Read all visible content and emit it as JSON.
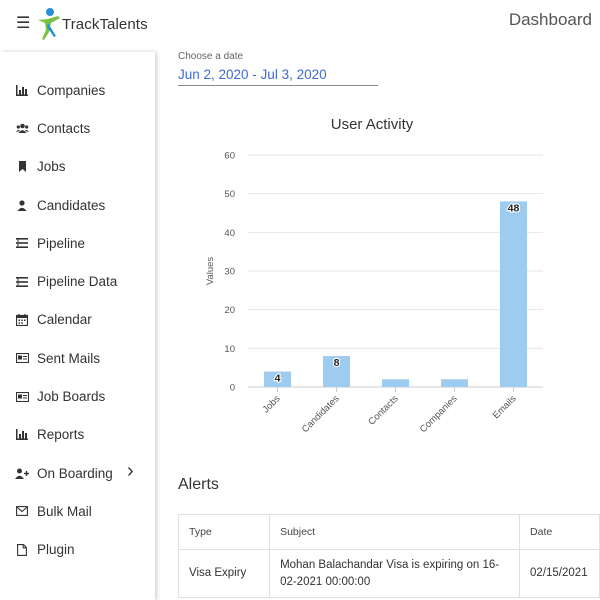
{
  "header": {
    "brand": "TrackTalents",
    "page_title": "Dashboard"
  },
  "sidebar": {
    "items": [
      {
        "label": "Companies",
        "icon": "bar-chart-icon"
      },
      {
        "label": "Contacts",
        "icon": "users-icon"
      },
      {
        "label": "Jobs",
        "icon": "bookmark-icon"
      },
      {
        "label": "Candidates",
        "icon": "user-icon"
      },
      {
        "label": "Pipeline",
        "icon": "list-icon"
      },
      {
        "label": "Pipeline Data",
        "icon": "list-icon"
      },
      {
        "label": "Calendar",
        "icon": "calendar-icon"
      },
      {
        "label": "Sent Mails",
        "icon": "card-icon"
      },
      {
        "label": "Job Boards",
        "icon": "card-icon"
      },
      {
        "label": "Reports",
        "icon": "bar-chart-icon"
      },
      {
        "label": "On Boarding",
        "icon": "user-plus-icon",
        "has_submenu": true
      },
      {
        "label": "Bulk Mail",
        "icon": "envelope-icon"
      },
      {
        "label": "Plugin",
        "icon": "file-icon"
      }
    ]
  },
  "date_picker": {
    "label": "Choose a date",
    "value": "Jun 2, 2020 - Jul 3, 2020"
  },
  "chart_data": {
    "type": "bar",
    "title": "User Activity",
    "ylabel": "Values",
    "xlabel": "",
    "categories": [
      "Jobs",
      "Candidates",
      "Contacts",
      "Companies",
      "Emails"
    ],
    "values": [
      4,
      8,
      2,
      2,
      48
    ],
    "data_labels": [
      "4",
      "8",
      "",
      "",
      "48"
    ],
    "ylim": [
      0,
      60
    ],
    "yticks": [
      0,
      10,
      20,
      30,
      40,
      50,
      60
    ],
    "grid": true,
    "legend": "none",
    "bar_color": "#9ecbf0"
  },
  "alerts": {
    "title": "Alerts",
    "columns": [
      "Type",
      "Subject",
      "Date"
    ],
    "rows": [
      {
        "type": "Visa Expiry",
        "subject": "Mohan Balachandar Visa is expiring on 16-02-2021 00:00:00",
        "date": "02/15/2021"
      }
    ]
  },
  "colors": {
    "accent": "#3f6ad8",
    "logo_blue": "#2a8fd6",
    "logo_green": "#7cc242"
  }
}
